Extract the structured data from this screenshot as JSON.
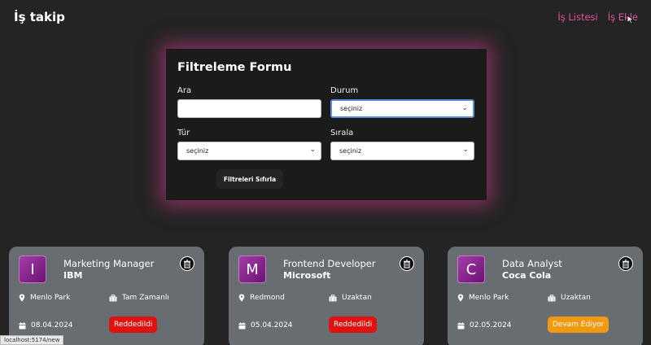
{
  "header": {
    "brand": "İş takip",
    "nav": [
      "İş Listesi",
      "İş Ekle"
    ]
  },
  "filter_form": {
    "title": "Filtreleme Formu",
    "search_label": "Ara",
    "search_value": "",
    "status_label": "Durum",
    "status_value": "seçiniz",
    "type_label": "Tür",
    "type_value": "seçiniz",
    "sort_label": "Sırala",
    "sort_value": "seçiniz",
    "reset_label": "Filtreleri Sıfırla"
  },
  "jobs": [
    {
      "initial": "I",
      "position": "Marketing Manager",
      "company": "IBM",
      "location": "Menlo Park",
      "type": "Tam Zamanlı",
      "date": "08.04.2024",
      "status": "Reddedildi",
      "status_color": "#e0120f"
    },
    {
      "initial": "M",
      "position": "Frontend Developer",
      "company": "Microsoft",
      "location": "Redmond",
      "type": "Uzaktan",
      "date": "05.04.2024",
      "status": "Reddedildi",
      "status_color": "#e0120f"
    },
    {
      "initial": "C",
      "position": "Data Analyst",
      "company": "Coca Cola",
      "location": "Menlo Park",
      "type": "Uzaktan",
      "date": "02.05.2024",
      "status": "Devam Ediyor",
      "status_color": "#f29a0f"
    }
  ],
  "colors": {
    "accent": "#e0529f",
    "card_bg": "#676d71",
    "page_bg": "#242424"
  },
  "statusbar": {
    "url": "localhost:5174/new"
  }
}
